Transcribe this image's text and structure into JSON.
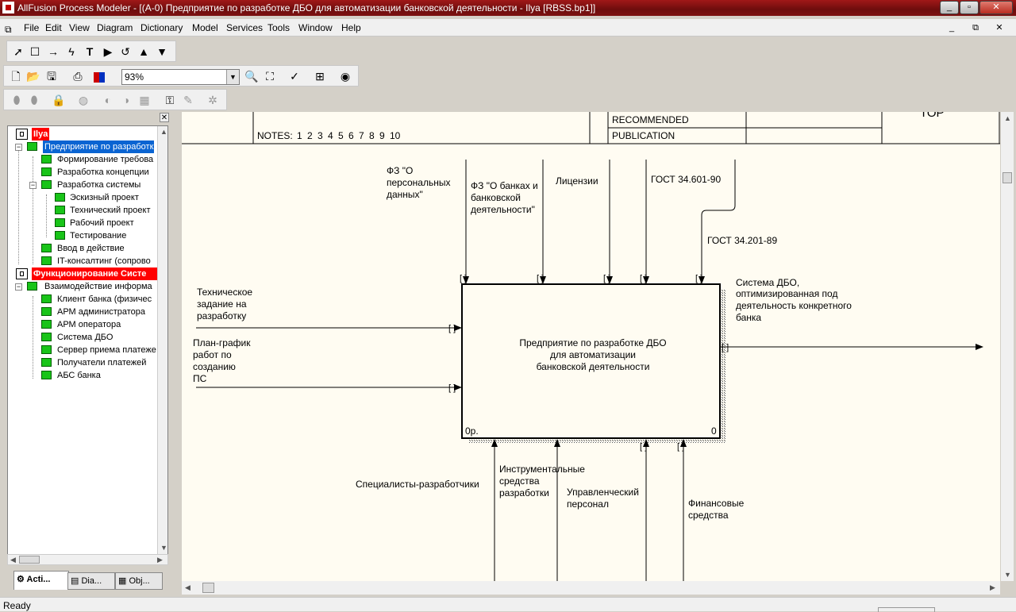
{
  "window": {
    "title": "AllFusion Process Modeler - [(A-0) Предприятие по разработке ДБО  для автоматизации  банковской деятельности - Ilya  [RBSS.bp1]]",
    "controls": {
      "minimize": "_",
      "maximize": "▫",
      "close": "✕"
    }
  },
  "menu": {
    "items": [
      "File",
      "Edit",
      "View",
      "Diagram",
      "Dictionary",
      "Model",
      "Services",
      "Tools",
      "Window",
      "Help"
    ],
    "mdi": {
      "minimize": "_",
      "restore": "⧉",
      "close": "✕"
    }
  },
  "toolbar": {
    "zoom": "93%",
    "tools": [
      "pointer-icon",
      "box-icon",
      "arrow-icon",
      "squiggle-icon",
      "text-icon",
      "play-icon",
      "undo-icon",
      "up-icon",
      "down-icon"
    ]
  },
  "tree": {
    "items": [
      {
        "label": "Ilya",
        "style": "red"
      },
      {
        "label": "Предприятие по разработке",
        "style": "selected"
      },
      {
        "label": "Формирование требова"
      },
      {
        "label": "Разработка концепции"
      },
      {
        "label": "Разработка системы"
      },
      {
        "label": "Эскизный проект"
      },
      {
        "label": "Технический проект"
      },
      {
        "label": "Рабочий проект"
      },
      {
        "label": "Тестирование"
      },
      {
        "label": "Ввод в действие"
      },
      {
        "label": "IT-консалтинг (сопрово"
      },
      {
        "label": "Функционирование Систе",
        "style": "red"
      },
      {
        "label": "Взаимодействие информа"
      },
      {
        "label": "Клиент банка  (физичес"
      },
      {
        "label": "АРМ администратора"
      },
      {
        "label": "АРМ оператора"
      },
      {
        "label": "Система ДБО"
      },
      {
        "label": "Сервер приема платеже"
      },
      {
        "label": "Получатели платежей"
      },
      {
        "label": "АБС банка"
      }
    ],
    "tabs": [
      "Acti...",
      "Dia...",
      "Obj..."
    ]
  },
  "frame": {
    "notes_label": "NOTES:",
    "notes_numbers": [
      "1",
      "2",
      "3",
      "4",
      "5",
      "6",
      "7",
      "8",
      "9",
      "10"
    ],
    "recommended": "RECOMMENDED",
    "publication": "PUBLICATION",
    "top_label": "TOP"
  },
  "diagram": {
    "box": {
      "title_lines": [
        "Предприятие по разработке ДБО",
        "для автоматизации",
        "банковской деятельности"
      ],
      "cost": "0р.",
      "number": "0"
    },
    "controls": [
      {
        "lines": [
          "ФЗ \"О",
          "персональных",
          "данных\""
        ]
      },
      {
        "lines": [
          "ФЗ \"О банках и",
          "банковской",
          "деятельности\""
        ]
      },
      {
        "lines": [
          "Лицензии"
        ]
      },
      {
        "lines": [
          "ГОСТ 34.601-90"
        ]
      },
      {
        "lines": [
          "ГОСТ 34.201-89"
        ]
      }
    ],
    "inputs": [
      {
        "lines": [
          "Техническое",
          "задание на",
          "разработку"
        ]
      },
      {
        "lines": [
          "План-график",
          "работ по",
          "созданию",
          "ПС"
        ]
      }
    ],
    "outputs": [
      {
        "lines": [
          "Система ДБО,",
          "оптимизированная под",
          "деятельность конкретного",
          "банка"
        ]
      }
    ],
    "mechanisms": [
      {
        "lines": [
          "Специалисты-разработчики"
        ]
      },
      {
        "lines": [
          "Инструментальные",
          "средства",
          "разработки"
        ]
      },
      {
        "lines": [
          "Управленческий",
          "персонал"
        ]
      },
      {
        "lines": [
          "Финансовые",
          "средства"
        ]
      }
    ]
  },
  "status": {
    "text": "Ready"
  }
}
